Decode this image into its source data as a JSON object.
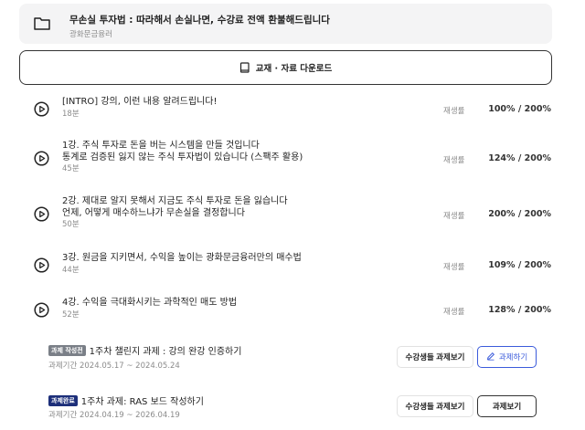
{
  "course": {
    "title": "무손실 투자법 : 따라해서 손실나면, 수강료 전액 환불해드립니다",
    "instructor": "광화문금융러"
  },
  "download": {
    "label": "교재 · 자료 다운로드",
    "icon": "book-icon"
  },
  "lectures": [
    {
      "lines": [
        "[INTRO] 강의, 이런 내용 알려드립니다!"
      ],
      "duration": "18분",
      "rate_label": "재생률",
      "rate": "100% / 200%"
    },
    {
      "lines": [
        "1강. 주식 투자로 돈을 버는 시스템을 만들 것입니다",
        "통계로 검증된 잃지 않는 주식 투자법이 있습니다 (스팩주 활용)"
      ],
      "duration": "45분",
      "rate_label": "재생률",
      "rate": "124% / 200%"
    },
    {
      "lines": [
        "2강. 제대로 알지 못해서 지금도 주식 투자로 돈을 잃습니다",
        "언제, 어떻게 매수하느냐가 무손실을 결정합니다"
      ],
      "duration": "50분",
      "rate_label": "재생률",
      "rate": "200% / 200%"
    },
    {
      "lines": [
        "3강. 원금을 지키면서, 수익을 높이는 광화문금융러만의 매수법"
      ],
      "duration": "44분",
      "rate_label": "재생률",
      "rate": "109% / 200%"
    },
    {
      "lines": [
        "4강. 수익을 극대화시키는 과학적인 매도 방법"
      ],
      "duration": "52분",
      "rate_label": "재생률",
      "rate": "128% / 200%"
    }
  ],
  "assignments": [
    {
      "badge": "과제 작성전",
      "badge_color": "#7a7f87",
      "title": "1주차 챌린지 과제 : 강의 완강 인증하기",
      "period": "과제기간 2024.05.17 ~ 2024.05.24",
      "view_label": "수강생들 과제보기",
      "action_label": "과제하기",
      "action_icon": "pencil-icon"
    },
    {
      "badge": "과제완료",
      "badge_color": "#1d2f7a",
      "title": "1주차 과제: RAS 보드 작성하기",
      "period": "과제기간 2024.04.19 ~ 2026.04.19",
      "view_label": "수강생들 과제보기",
      "action_label": "과제보기"
    }
  ]
}
